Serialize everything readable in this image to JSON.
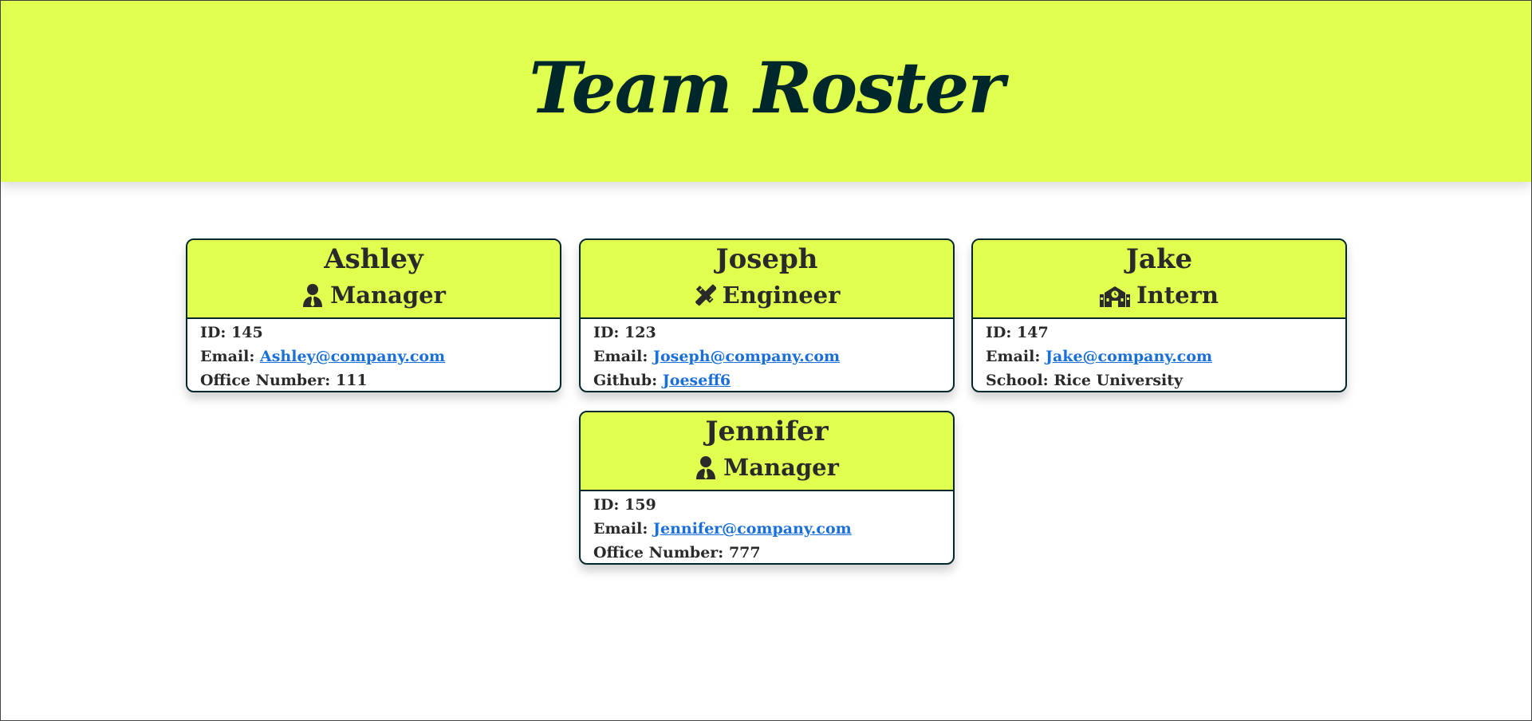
{
  "header": {
    "title": "Team Roster",
    "background_color": "#e0ff4f",
    "title_color": "#00272b"
  },
  "cards": [
    {
      "name": "Ashley",
      "role": "Manager",
      "role_icon": "user-tie-icon",
      "id_label": "ID:",
      "id": "145",
      "email_label": "Email:",
      "email": "Ashley@company.com",
      "extra_label": "Office Number:",
      "extra_value": "111"
    },
    {
      "name": "Joseph",
      "role": "Engineer",
      "role_icon": "pencil-ruler-icon",
      "id_label": "ID:",
      "id": "123",
      "email_label": "Email:",
      "email": "Joseph@company.com",
      "extra_label": "Github:",
      "extra_value": "Joeseff6"
    },
    {
      "name": "Jake",
      "role": "Intern",
      "role_icon": "school-icon",
      "id_label": "ID:",
      "id": "147",
      "email_label": "Email:",
      "email": "Jake@company.com",
      "extra_label": "School:",
      "extra_value": "Rice University"
    },
    {
      "name": "Jennifer",
      "role": "Manager",
      "role_icon": "user-tie-icon",
      "id_label": "ID:",
      "id": "159",
      "email_label": "Email:",
      "email": "Jennifer@company.com",
      "extra_label": "Office Number:",
      "extra_value": "777"
    }
  ],
  "colors": {
    "accent": "#e0ff4f",
    "border": "#00272b",
    "link": "#1a6fd8"
  }
}
